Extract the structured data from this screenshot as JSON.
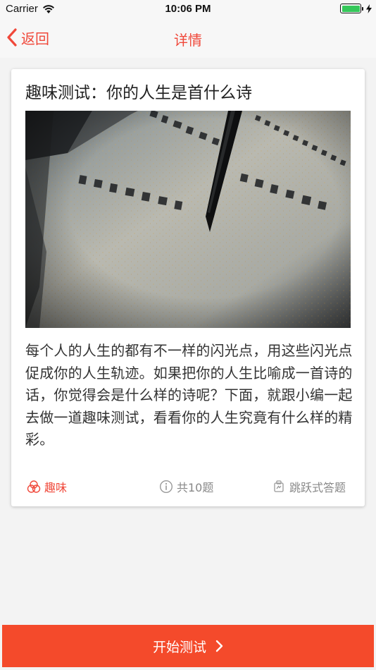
{
  "status_bar": {
    "carrier": "Carrier",
    "time": "10:06 PM",
    "battery_level": 1.0,
    "battery_color": "#34c759"
  },
  "nav": {
    "back_label": "返回",
    "back_icon": "chevron-left-icon",
    "title": "详情",
    "accent_color": "#f0483a"
  },
  "card": {
    "title": "趣味测试：你的人生是首什么诗",
    "image_alt": "calligraphy-brush-on-paper",
    "description": "每个人的人生的都有不一样的闪光点，用这些闪光点促成你的人生轨迹。如果把你的人生比喻成一首诗的话，你觉得会是什么样的诗呢？下面，就跟小编一起去做一道趣味测试，看看你的人生究竟有什么样的精彩。",
    "meta": {
      "tag": "趣味",
      "tag_icon": "circles-icon",
      "count": "共10题",
      "count_icon": "info-icon",
      "mode": "跳跃式答题",
      "mode_icon": "jump-icon"
    }
  },
  "footer": {
    "start_label": "开始测试",
    "start_icon": "chevron-right-icon",
    "button_color": "#f44a2b"
  }
}
